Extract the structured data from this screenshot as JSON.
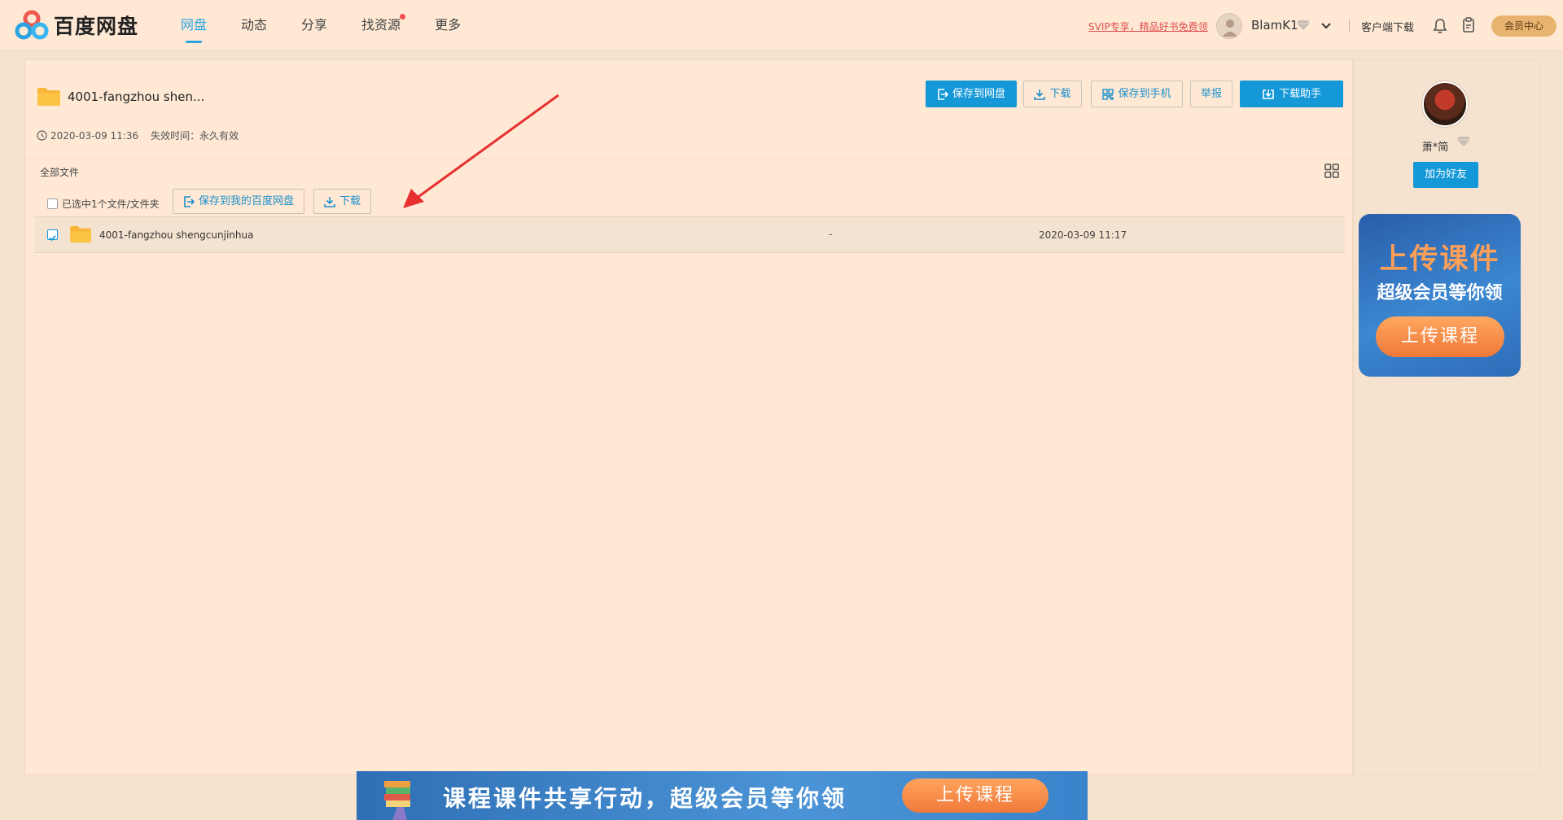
{
  "header": {
    "logo_text": "百度网盘",
    "nav": [
      {
        "label": "网盘",
        "active": true
      },
      {
        "label": "动态",
        "active": false
      },
      {
        "label": "分享",
        "active": false
      },
      {
        "label": "找资源",
        "active": false,
        "dot": true
      },
      {
        "label": "更多",
        "active": false
      }
    ],
    "promo": "SVIP专享，精品好书免费领",
    "username": "BlamK1",
    "client_download": "客户端下载",
    "member_center": "会员中心"
  },
  "share": {
    "title": "4001-fangzhou  shen...",
    "created": "2020-03-09 11:36",
    "expire_label": "失效时间：永久有效",
    "buttons": {
      "save_to_pan": "保存到网盘",
      "download": "下载",
      "save_to_phone": "保存到手机",
      "report": "举报",
      "download_helper": "下载助手"
    }
  },
  "files": {
    "breadcrumb": "全部文件",
    "selected_label": "已选中1个文件/文件夹",
    "save_mine": "保存到我的百度网盘",
    "download": "下载",
    "rows": [
      {
        "name": "4001-fangzhou shengcunjinhua",
        "size": "-",
        "date": "2020-03-09 11:17",
        "checked": true
      }
    ]
  },
  "sidebar": {
    "sharer_name": "萧*简",
    "add_friend": "加为好友",
    "ad": {
      "title": "上传课件",
      "subtitle": "超级会员等你领",
      "button": "上传课程"
    }
  },
  "bottom_banner": {
    "text": "课程课件共享行动，超级会员等你领",
    "button": "上传课程"
  },
  "colors": {
    "accent": "#1498d8",
    "background": "#ffe9d5",
    "promo": "#e04f4f",
    "folder": "#f8b73a",
    "arrow": "#e83030"
  }
}
